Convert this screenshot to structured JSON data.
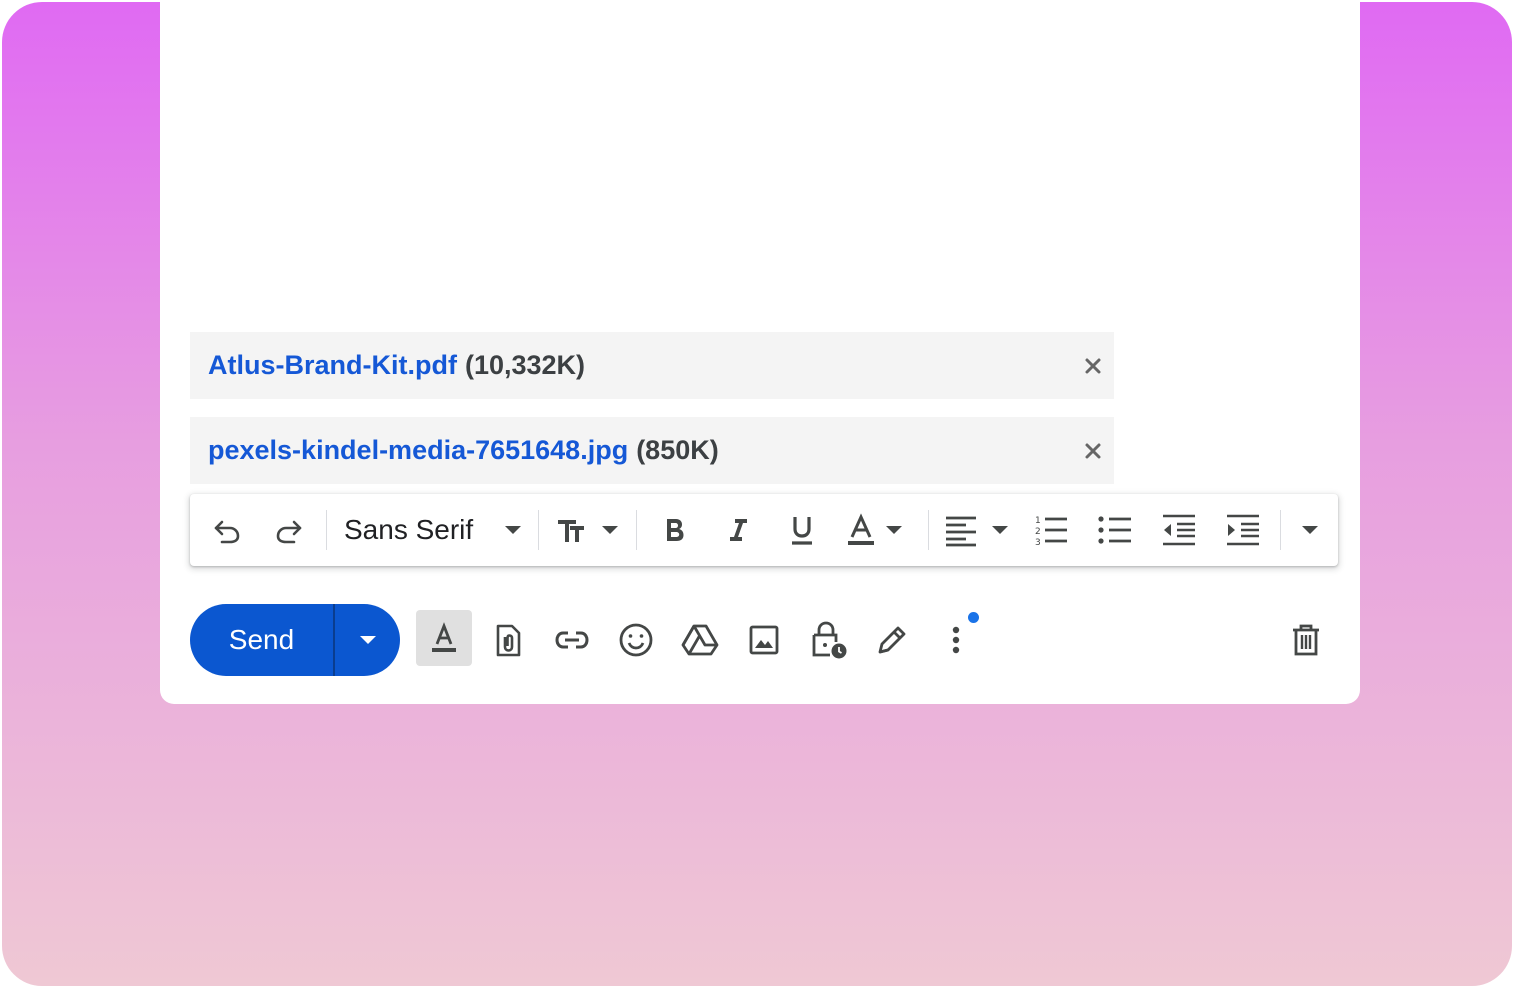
{
  "compose": {
    "attachments": [
      {
        "name": "Atlus-Brand-Kit.pdf",
        "size": "(10,332K)",
        "remove_icon": "close-icon"
      },
      {
        "name": "pexels-kindel-media-7651648.jpg",
        "size": "(850K)",
        "remove_icon": "close-icon"
      }
    ],
    "formatting_toolbar": {
      "font_family": "Sans Serif",
      "icons": [
        "undo-icon",
        "redo-icon",
        "font-size-icon",
        "bold-icon",
        "italic-icon",
        "underline-icon",
        "text-color-icon",
        "align-icon",
        "numbered-list-icon",
        "bulleted-list-icon",
        "indent-less-icon",
        "indent-more-icon",
        "more-formatting-icon"
      ]
    },
    "bottom_toolbar": {
      "send_label": "Send",
      "icons": [
        "formatting-options-icon",
        "attach-file-icon",
        "insert-link-icon",
        "emoji-icon",
        "drive-icon",
        "insert-photo-icon",
        "confidential-mode-icon",
        "signature-icon",
        "more-options-icon",
        "discard-draft-icon"
      ],
      "formatting_options_active": true,
      "more_options_notification": true
    }
  },
  "colors": {
    "accent": "#0b57d0",
    "link": "#1558d6",
    "icon": "#444746",
    "notification": "#1a73e8",
    "gradient_top": "#e06af3",
    "gradient_bottom": "#efc8d4"
  }
}
